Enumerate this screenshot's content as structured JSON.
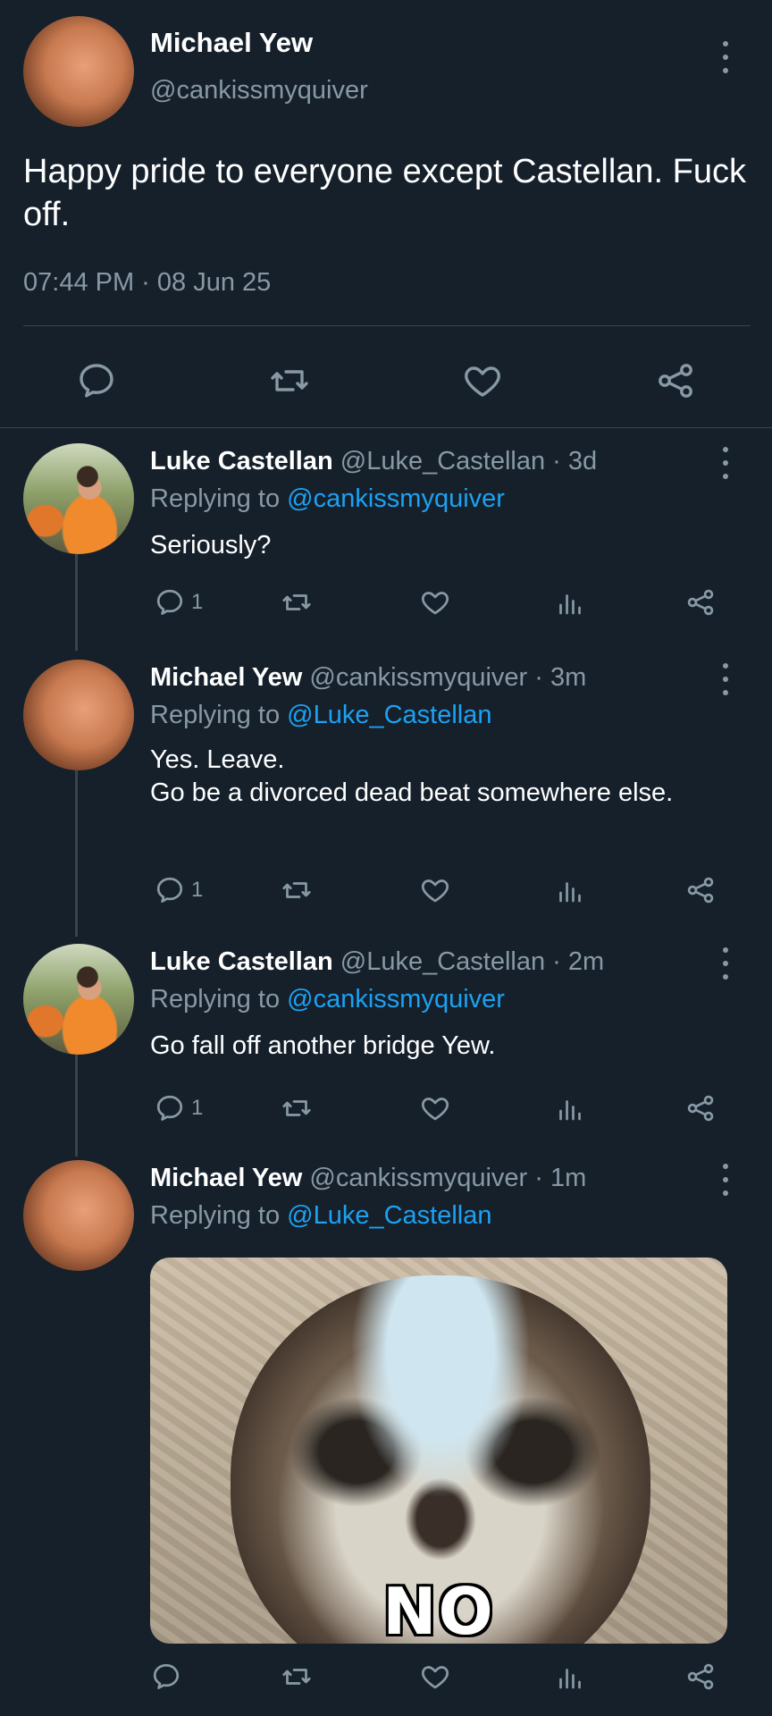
{
  "main_tweet": {
    "name": "Michael Yew",
    "handle": "@cankissmyquiver",
    "text": "Happy pride to everyone except Castellan. Fuck off.",
    "timestamp": "07:44 PM · 08 Jun 25",
    "actions": [
      "reply-icon",
      "retweet-icon",
      "like-icon",
      "share-icon"
    ]
  },
  "replies": [
    {
      "name": "Luke Castellan",
      "handle": "@Luke_Castellan · 3d",
      "replying_prefix": "Replying to",
      "replying_to": "@cankissmyquiver",
      "text": "Seriously?",
      "reply_count": "1"
    },
    {
      "name": "Michael Yew",
      "handle": "@cankissmyquiver · 3m",
      "replying_prefix": "Replying to",
      "replying_to": "@Luke_Castellan",
      "text_lines": [
        "Yes. Leave.",
        "Go be a divorced dead beat somewhere else."
      ],
      "reply_count": "1"
    },
    {
      "name": "Luke Castellan",
      "handle": "@Luke_Castellan · 2m",
      "replying_prefix": "Replying to",
      "replying_to": "@cankissmyquiver",
      "text": "Go fall off another bridge Yew.",
      "reply_count": "1"
    },
    {
      "name": "Michael Yew",
      "handle": "@cankissmyquiver · 1m",
      "replying_prefix": "Replying to",
      "replying_to": "@Luke_Castellan",
      "media_caption": "NO",
      "reply_count": ""
    }
  ],
  "colors": {
    "background": "#15202b",
    "secondary_text": "#8899a6",
    "link": "#1da1f2",
    "divider": "#38444d"
  }
}
